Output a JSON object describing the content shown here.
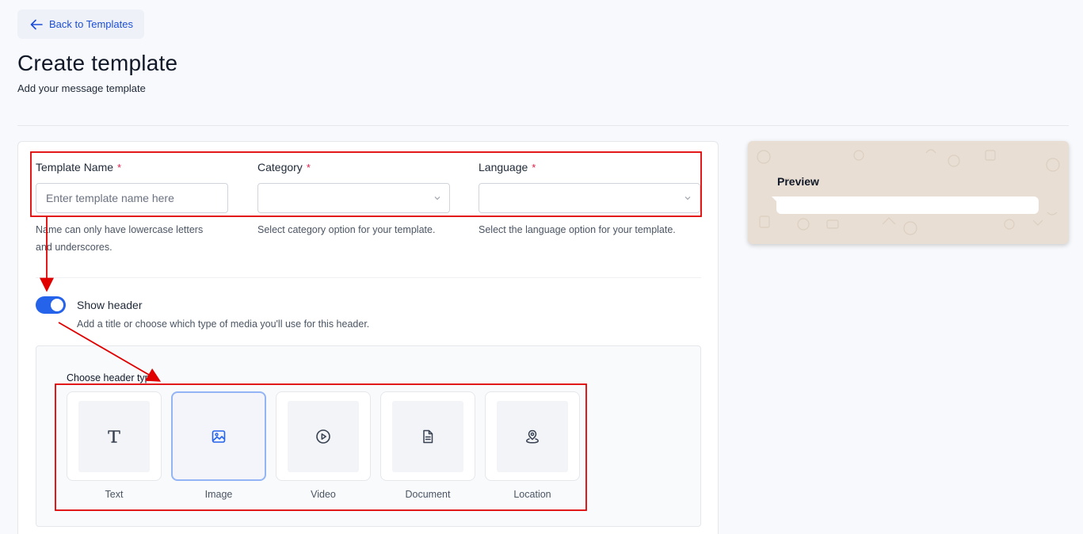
{
  "back": {
    "label": "Back to Templates"
  },
  "page": {
    "title": "Create template",
    "subtitle": "Add your message template"
  },
  "form": {
    "template_name": {
      "label": "Template Name",
      "required_mark": "*",
      "value": "",
      "placeholder": "Enter template name here",
      "help_line1": "Name can only have lowercase letters",
      "help_line2": "and underscores."
    },
    "category": {
      "label": "Category",
      "required_mark": "*",
      "selected": "",
      "help": "Select category option for your template."
    },
    "language": {
      "label": "Language",
      "required_mark": "*",
      "selected": "",
      "help": "Select the language option for your template."
    }
  },
  "header_toggle": {
    "label": "Show header",
    "on": true,
    "help": "Add a title or choose which type of media you'll use for this header."
  },
  "header_types": {
    "label": "Choose header type",
    "items": [
      {
        "label": "Text",
        "icon": "text-icon",
        "selected": false
      },
      {
        "label": "Image",
        "icon": "image-icon",
        "selected": true
      },
      {
        "label": "Video",
        "icon": "video-icon",
        "selected": false
      },
      {
        "label": "Document",
        "icon": "document-icon",
        "selected": false
      },
      {
        "label": "Location",
        "icon": "location-icon",
        "selected": false
      }
    ]
  },
  "preview": {
    "title": "Preview"
  },
  "colors": {
    "accent": "#2563eb",
    "annotation": "#e00000",
    "required": "#e11d48",
    "preview_bg": "#e8ded3"
  }
}
